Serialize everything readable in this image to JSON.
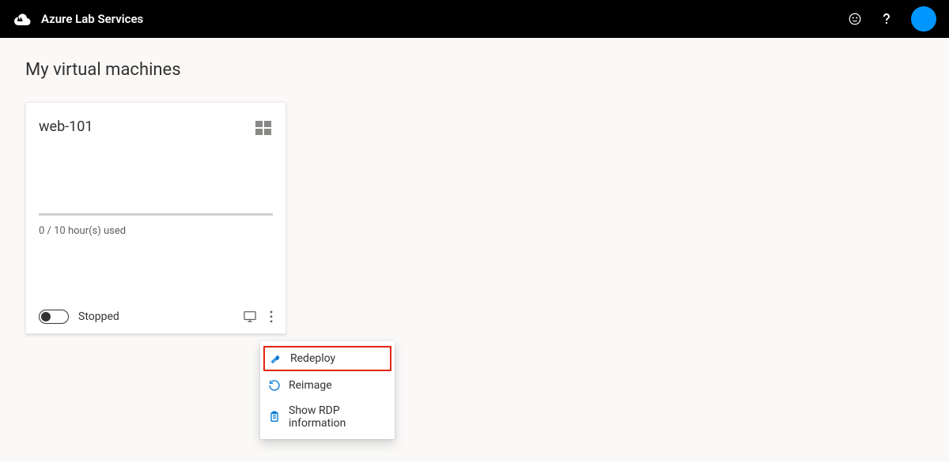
{
  "header": {
    "title": "Azure Lab Services"
  },
  "page": {
    "title": "My virtual machines"
  },
  "vm": {
    "name": "web-101",
    "usage": "0 / 10 hour(s) used",
    "status": "Stopped"
  },
  "menu": {
    "redeploy": "Redeploy",
    "reimage": "Reimage",
    "show_rdp": "Show RDP information"
  }
}
